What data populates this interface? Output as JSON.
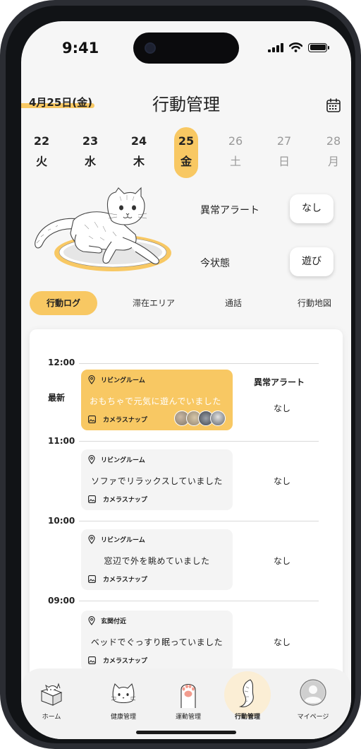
{
  "status_bar": {
    "time": "9:41"
  },
  "header": {
    "date": "4月25日(金)",
    "title": "行動管理",
    "calendar_icon": "calendar-icon"
  },
  "days": [
    {
      "num": "22",
      "weekday": "火",
      "state": "past"
    },
    {
      "num": "23",
      "weekday": "水",
      "state": "past"
    },
    {
      "num": "24",
      "weekday": "木",
      "state": "past"
    },
    {
      "num": "25",
      "weekday": "金",
      "state": "selected"
    },
    {
      "num": "26",
      "weekday": "土",
      "state": "future"
    },
    {
      "num": "27",
      "weekday": "日",
      "state": "future"
    },
    {
      "num": "28",
      "weekday": "月",
      "state": "future"
    }
  ],
  "status": {
    "alert_label": "異常アラート",
    "alert_value": "なし",
    "state_label": "今状態",
    "state_value": "遊び"
  },
  "tabs": [
    {
      "label": "行動ログ",
      "active": true
    },
    {
      "label": "滞在エリア",
      "active": false
    },
    {
      "label": "通話",
      "active": false
    },
    {
      "label": "行動地図",
      "active": false
    }
  ],
  "log": {
    "latest_label": "最新",
    "alert_header": "異常アラート",
    "entries": [
      {
        "time": "12:00",
        "location": "リビングルーム",
        "description": "おもちゃで元気に遊んでいました",
        "snap": "カメラスナップ",
        "alert": "なし",
        "highlight": true
      },
      {
        "time": "11:00",
        "location": "リビングルーム",
        "description": "ソファでリラックスしていました",
        "snap": "カメラスナップ",
        "alert": "なし",
        "highlight": false
      },
      {
        "time": "10:00",
        "location": "リビングルーム",
        "description": "窓辺で外を眺めていました",
        "snap": "カメラスナップ",
        "alert": "なし",
        "highlight": false
      },
      {
        "time": "09:00",
        "location": "玄関付近",
        "description": "ベッドでぐっすり眠っていました",
        "snap": "カメラスナップ",
        "alert": "なし",
        "highlight": false
      }
    ]
  },
  "nav": [
    {
      "label": "ホーム",
      "icon": "home-box-cat-icon",
      "active": false
    },
    {
      "label": "健康管理",
      "icon": "cat-face-icon",
      "active": false
    },
    {
      "label": "運動管理",
      "icon": "paw-icon",
      "active": false
    },
    {
      "label": "行動管理",
      "icon": "cat-tail-icon",
      "active": true
    },
    {
      "label": "マイページ",
      "icon": "profile-icon",
      "active": false
    }
  ],
  "colors": {
    "accent": "#f8c863",
    "background": "#f6f6f6",
    "card": "#ffffff"
  }
}
